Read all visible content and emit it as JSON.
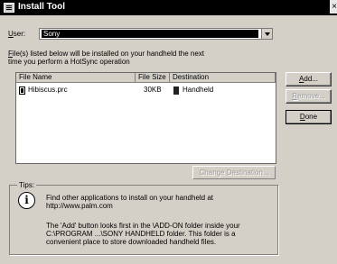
{
  "window": {
    "title": "Install Tool",
    "close_label": "×"
  },
  "user": {
    "label": "User:",
    "label_accel": "U",
    "label_rest": "ser:",
    "selected": "Sony"
  },
  "description": {
    "line1_accel": "F",
    "line1_rest": "ile(s) listed below will be installed on your handheld the next",
    "line2": "time you perform a HotSync operation"
  },
  "file_list": {
    "columns": [
      "File Name",
      "File Size",
      "Destination"
    ],
    "rows": [
      {
        "name": "Hibiscus.prc",
        "size": "30KB",
        "destination": "Handheld"
      }
    ]
  },
  "buttons": {
    "add": "Add...",
    "add_accel": "A",
    "add_rest": "dd...",
    "remove": "Remove...",
    "remove_accel": "R",
    "remove_rest": "emove...",
    "done": "Done",
    "done_accel": "D",
    "done_rest": "one",
    "change_destination": "Change Destination..."
  },
  "tips": {
    "label": "Tips:",
    "line1": "Find other applications to install on your handheld at",
    "line2": "http://www.palm.com",
    "line3": "The 'Add' button looks first in the \\ADD-ON folder inside your",
    "line4": "C:\\PROGRAM ...\\SONY HANDHELD folder. This folder is a",
    "line5": "convenient place to store downloaded handheld files."
  }
}
